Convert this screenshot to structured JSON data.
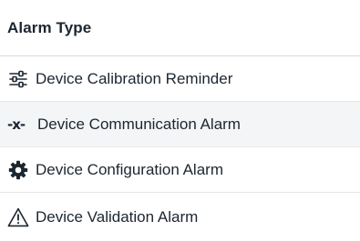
{
  "table": {
    "header": "Alarm Type",
    "rows": [
      {
        "label": "Device Calibration Reminder",
        "icon": "sliders-icon"
      },
      {
        "label": "Device Communication Alarm",
        "icon": "communication-loss-icon",
        "glyph": "-x-"
      },
      {
        "label": "Device Configuration Alarm",
        "icon": "gear-icon"
      },
      {
        "label": "Device Validation Alarm",
        "icon": "warning-triangle-icon"
      }
    ]
  },
  "colors": {
    "text": "#1c2630",
    "row_alt_background": "#f4f5f6",
    "divider": "#d4d8dc"
  }
}
